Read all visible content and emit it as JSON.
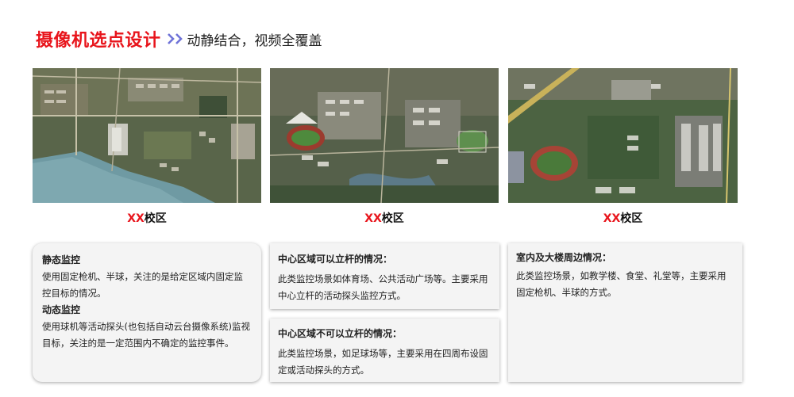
{
  "header": {
    "title": "摄像机选点设计",
    "subtitle": "动静结合，视频全覆盖",
    "arrow_icon": "double-chevron-right-icon",
    "colors": {
      "title": "#e8141b",
      "arrows": "#6f73d8"
    }
  },
  "campuses": [
    {
      "prefix": "XX",
      "suffix": "校区"
    },
    {
      "prefix": "XX",
      "suffix": "校区"
    },
    {
      "prefix": "XX",
      "suffix": "校区"
    }
  ],
  "cards": {
    "monitoring": {
      "static_title": "静态监控",
      "static_text": "使用固定枪机、半球，关注的是给定区域内固定监控目标的情况。",
      "dynamic_title": "动态监控",
      "dynamic_text": "使用球机等活动探头(也包括自动云台摄像系统)监视目标，关注的是一定范围内不确定的监控事件。"
    },
    "pole_possible": {
      "title": "中心区域可以立杆的情况：",
      "text": "此类监控场景如体育场、公共活动广场等。主要采用中心立杆的活动探头监控方式。"
    },
    "pole_impossible": {
      "title": "中心区域不可以立杆的情况：",
      "text": "此类监控场景，如足球场等，主要采用在四周布设固定或活动探头的方式。"
    },
    "indoor": {
      "title": "室内及大楼周边情况：",
      "text": "此类监控场景，如教学楼、食堂、礼堂等，主要采用固定枪机、半球的方式。"
    }
  }
}
